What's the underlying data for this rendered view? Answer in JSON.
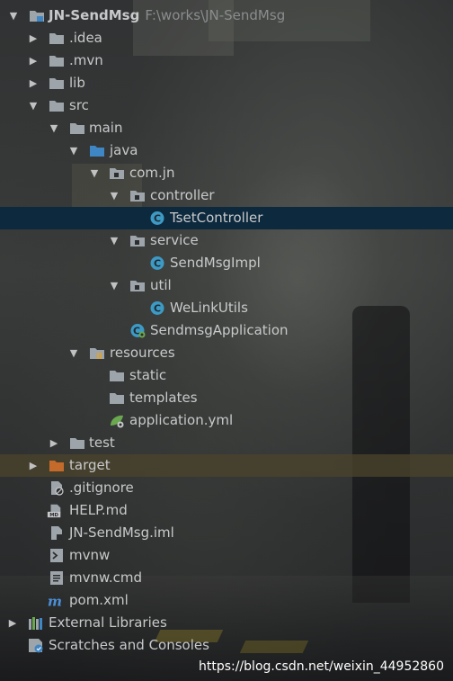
{
  "project": {
    "name": "JN-SendMsg",
    "path": "F:\\works\\JN-SendMsg"
  },
  "tree": {
    "idea": ".idea",
    "mvn": ".mvn",
    "lib": "lib",
    "src": "src",
    "main": "main",
    "java": "java",
    "com_jn": "com.jn",
    "controller": "controller",
    "tset_controller": "TsetController",
    "service": "service",
    "send_msg_impl": "SendMsgImpl",
    "util": "util",
    "welink_utils": "WeLinkUtils",
    "sendmsg_application": "SendmsgApplication",
    "resources": "resources",
    "static": "static",
    "templates": "templates",
    "application_yml": "application.yml",
    "test": "test",
    "target": "target",
    "gitignore": ".gitignore",
    "help_md": "HELP.md",
    "iml": "JN-SendMsg.iml",
    "mvnw": "mvnw",
    "mvnw_cmd": "mvnw.cmd",
    "pom": "pom.xml",
    "external_libraries": "External Libraries",
    "scratches": "Scratches and Consoles"
  },
  "icons": {
    "folder": "folder-icon",
    "source_folder": "source-folder-icon",
    "package": "package-icon",
    "class": "class-icon",
    "spring_boot": "spring-boot-class-icon",
    "resources_folder": "resources-folder-icon",
    "yml": "yml-file-icon",
    "excluded_folder": "excluded-folder-icon",
    "gitignore": "gitignore-file-icon",
    "markdown": "markdown-file-icon",
    "iml": "iml-file-icon",
    "script": "script-file-icon",
    "maven": "maven-pom-icon",
    "libraries": "libraries-icon",
    "scratches": "scratches-icon"
  },
  "colors": {
    "selection": "#0d293e",
    "excluded_row": "#4a432c",
    "folder": "#9da4aa",
    "source_folder": "#3f86c4",
    "class_icon": "#3d9ac4",
    "target_folder": "#c46a2b",
    "text": "#c8c9ca",
    "hint_text": "#8b8c8e"
  },
  "watermark": "https://blog.csdn.net/weixin_44952860"
}
